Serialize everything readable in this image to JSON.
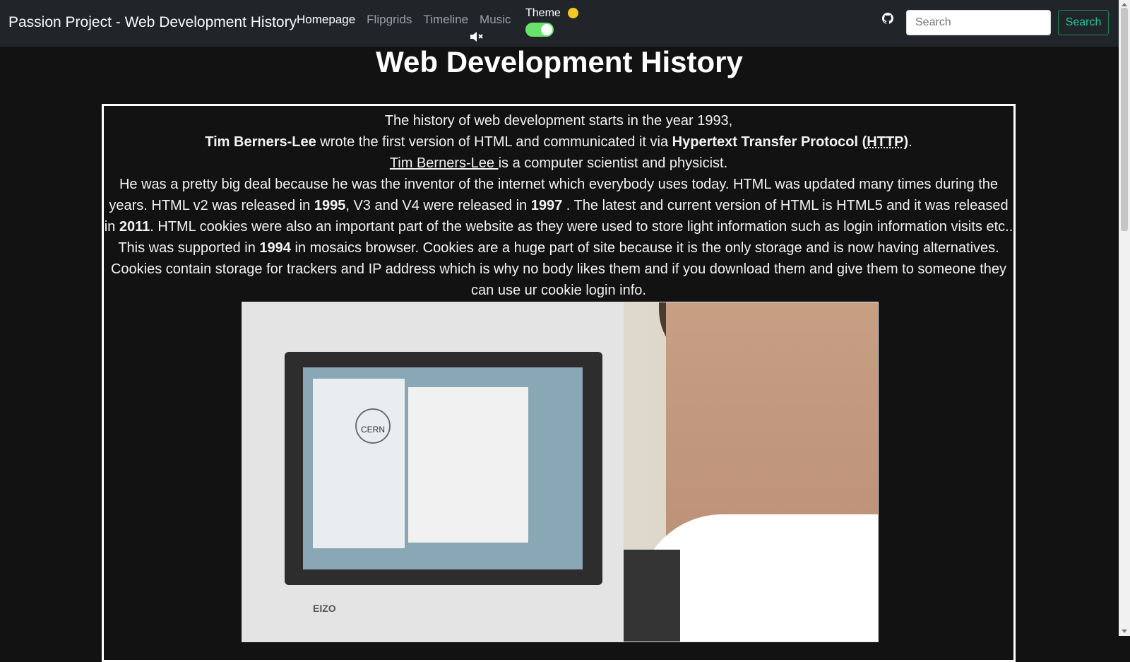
{
  "nav": {
    "brand": "Passion Project - Web Development History",
    "links": [
      "Homepage",
      "Flipgrids",
      "Timeline",
      "Music"
    ],
    "theme_label": "Theme",
    "search_placeholder": "Search",
    "search_button": "Search"
  },
  "main": {
    "title": "Web Development History",
    "p1": "The history of web development starts in the year 1993,",
    "p2": {
      "name": "Tim Berners-Lee",
      "text_a": " wrote the first version of HTML and communicated it via ",
      "protocol": "Hypertext Transfer Protocol (",
      "abbr": "HTTP",
      "protocol_end": ")",
      "end": "."
    },
    "p3": {
      "name_link": "Tim Berners-Lee ",
      "rest": "is a computer scientist and physicist."
    },
    "p4": {
      "a": "He was a pretty big deal because he was the inventor of the internet which everybody uses today. HTML was updated many times during the years. HTML v2 was released in ",
      "y1": "1995",
      "b": ", V3 and V4 were released in ",
      "y2": "1997",
      "c": " . The latest and current version of HTML is HTML5 and it was released in ",
      "y3": "2011",
      "d": ". HTML cookies were also an important part of the website as they were used to store light information such as login information visits etc.."
    },
    "p5": {
      "a": "This was supported in ",
      "y": "1994",
      "b": " in mosaics browser. Cookies are a huge part of site because it is the only storage and is now having alternatives. Cookies contain storage for trackers and IP address which is why no body likes them and if you download them and give them to someone they can use ur cookie login info."
    },
    "photo": {
      "screen_logo": "CERN",
      "monitor_brand": "EIZO"
    }
  }
}
